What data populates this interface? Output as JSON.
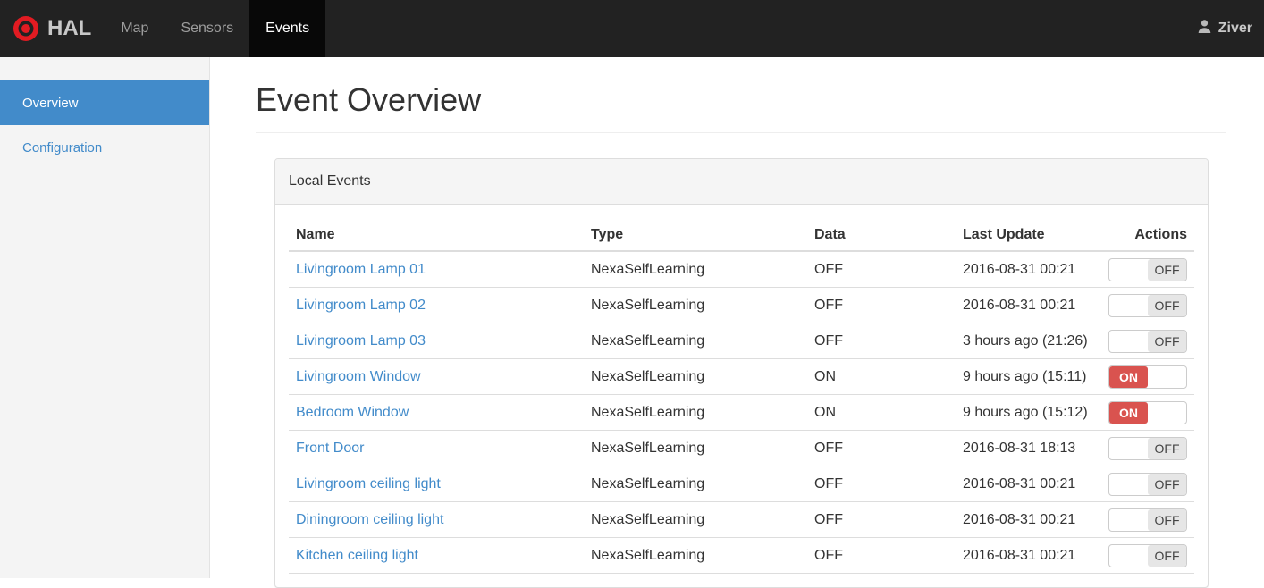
{
  "navbar": {
    "brand": "HAL",
    "items": [
      {
        "label": "Map",
        "active": false
      },
      {
        "label": "Sensors",
        "active": false
      },
      {
        "label": "Events",
        "active": true
      }
    ],
    "user": "Ziver"
  },
  "sidebar": {
    "items": [
      {
        "label": "Overview",
        "active": true
      },
      {
        "label": "Configuration",
        "active": false
      }
    ]
  },
  "main": {
    "title": "Event Overview",
    "panel": {
      "title": "Local Events",
      "table": {
        "columns": [
          "Name",
          "Type",
          "Data",
          "Last Update",
          "Actions"
        ],
        "rows": [
          {
            "name": "Livingroom Lamp 01",
            "type": "NexaSelfLearning",
            "data": "OFF",
            "last_update": "2016-08-31 00:21",
            "switch": "OFF"
          },
          {
            "name": "Livingroom Lamp 02",
            "type": "NexaSelfLearning",
            "data": "OFF",
            "last_update": "2016-08-31 00:21",
            "switch": "OFF"
          },
          {
            "name": "Livingroom Lamp 03",
            "type": "NexaSelfLearning",
            "data": "OFF",
            "last_update": "3 hours ago (21:26)",
            "switch": "OFF"
          },
          {
            "name": "Livingroom Window",
            "type": "NexaSelfLearning",
            "data": "ON",
            "last_update": "9 hours ago (15:11)",
            "switch": "ON"
          },
          {
            "name": "Bedroom Window",
            "type": "NexaSelfLearning",
            "data": "ON",
            "last_update": "9 hours ago (15:12)",
            "switch": "ON"
          },
          {
            "name": "Front Door",
            "type": "NexaSelfLearning",
            "data": "OFF",
            "last_update": "2016-08-31 18:13",
            "switch": "OFF"
          },
          {
            "name": "Livingroom ceiling light",
            "type": "NexaSelfLearning",
            "data": "OFF",
            "last_update": "2016-08-31 00:21",
            "switch": "OFF"
          },
          {
            "name": "Diningroom ceiling light",
            "type": "NexaSelfLearning",
            "data": "OFF",
            "last_update": "2016-08-31 00:21",
            "switch": "OFF"
          },
          {
            "name": "Kitchen ceiling light",
            "type": "NexaSelfLearning",
            "data": "OFF",
            "last_update": "2016-08-31 00:21",
            "switch": "OFF"
          }
        ]
      }
    }
  },
  "icons": {
    "logo": "target-icon",
    "user": "person-icon"
  },
  "colors": {
    "accent_blue": "#428bca",
    "switch_on_red": "#d9534f",
    "logo_red": "#e21b22",
    "navbar_bg": "#222222",
    "navbar_active_bg": "#080808",
    "sidebar_bg": "#f4f4f4",
    "panel_border": "#dddddd"
  }
}
